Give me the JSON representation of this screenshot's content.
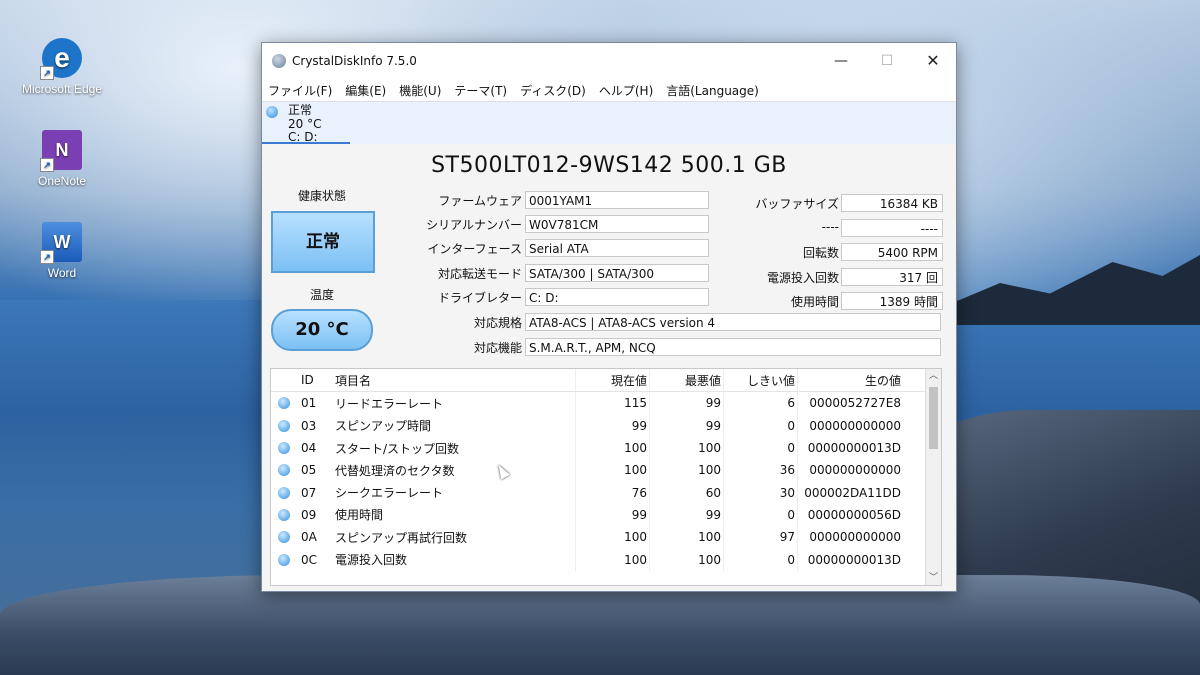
{
  "desktop": {
    "icons": [
      {
        "label": "Microsoft Edge",
        "glyph": "e"
      },
      {
        "label": "OneNote",
        "glyph": "N"
      },
      {
        "label": "Word",
        "glyph": "W"
      }
    ]
  },
  "window": {
    "title": "CrystalDiskInfo 7.5.0",
    "controls": {
      "minimize": "—",
      "maximize": "☐",
      "close": "✕"
    },
    "menu": [
      "ファイル(F)",
      "編集(E)",
      "機能(U)",
      "テーマ(T)",
      "ディスク(D)",
      "ヘルプ(H)",
      "言語(Language)"
    ],
    "drive_tab": {
      "status": "正常",
      "temp": "20 °C",
      "letters": "C: D:"
    },
    "model": "ST500LT012-9WS142 500.1 GB",
    "health": {
      "label": "健康状態",
      "value": "正常",
      "color": "#7cc0f4"
    },
    "temperature": {
      "label": "温度",
      "value": "20 °C"
    },
    "info_left": [
      {
        "label": "ファームウェア",
        "value": "0001YAM1"
      },
      {
        "label": "シリアルナンバー",
        "value": "W0V781CM"
      },
      {
        "label": "インターフェース",
        "value": "Serial ATA"
      },
      {
        "label": "対応転送モード",
        "value": "SATA/300 | SATA/300"
      },
      {
        "label": "ドライブレター",
        "value": "C: D:"
      }
    ],
    "info_right": [
      {
        "label": "バッファサイズ",
        "value": "16384 KB"
      },
      {
        "label": "----",
        "value": "----"
      },
      {
        "label": "回転数",
        "value": "5400 RPM"
      },
      {
        "label": "電源投入回数",
        "value": "317 回"
      },
      {
        "label": "使用時間",
        "value": "1389 時間"
      }
    ],
    "standard": {
      "label": "対応規格",
      "value": "ATA8-ACS | ATA8-ACS version 4"
    },
    "features": {
      "label": "対応機能",
      "value": "S.M.A.R.T., APM, NCQ"
    },
    "smart_table": {
      "headers": {
        "id": "ID",
        "name": "項目名",
        "current": "現在値",
        "worst": "最悪値",
        "threshold": "しきい値",
        "raw": "生の値"
      },
      "rows": [
        {
          "id": "01",
          "name": "リードエラーレート",
          "current": "115",
          "worst": "99",
          "threshold": "6",
          "raw": "0000052727E8"
        },
        {
          "id": "03",
          "name": "スピンアップ時間",
          "current": "99",
          "worst": "99",
          "threshold": "0",
          "raw": "000000000000"
        },
        {
          "id": "04",
          "name": "スタート/ストップ回数",
          "current": "100",
          "worst": "100",
          "threshold": "0",
          "raw": "00000000013D"
        },
        {
          "id": "05",
          "name": "代替処理済のセクタ数",
          "current": "100",
          "worst": "100",
          "threshold": "36",
          "raw": "000000000000"
        },
        {
          "id": "07",
          "name": "シークエラーレート",
          "current": "76",
          "worst": "60",
          "threshold": "30",
          "raw": "000002DA11DD"
        },
        {
          "id": "09",
          "name": "使用時間",
          "current": "99",
          "worst": "99",
          "threshold": "0",
          "raw": "00000000056D"
        },
        {
          "id": "0A",
          "name": "スピンアップ再試行回数",
          "current": "100",
          "worst": "100",
          "threshold": "97",
          "raw": "000000000000"
        },
        {
          "id": "0C",
          "name": "電源投入回数",
          "current": "100",
          "worst": "100",
          "threshold": "0",
          "raw": "00000000013D"
        }
      ]
    }
  }
}
